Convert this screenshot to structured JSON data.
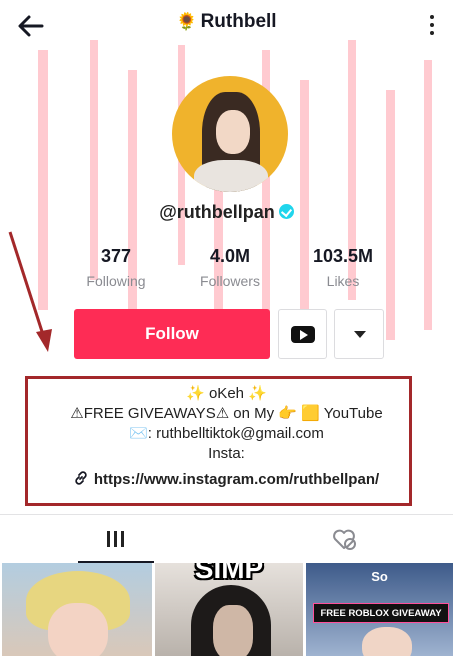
{
  "header": {
    "title": "Ruthbell",
    "title_emoji": "🌻"
  },
  "profile": {
    "handle": "@ruthbellpan",
    "stats": [
      {
        "value": "377",
        "label": "Following"
      },
      {
        "value": "4.0M",
        "label": "Followers"
      },
      {
        "value": "103.5M",
        "label": "Likes"
      }
    ],
    "follow_label": "Follow"
  },
  "bio": {
    "line1": "✨ oKeh ✨",
    "line2": "⚠FREE GIVEAWAYS⚠ on My 👉 🟨 YouTube",
    "line3": "✉️: ruthbelltiktok@gmail.com",
    "line4": "Insta:",
    "link": "https://www.instagram.com/ruthbellpan/"
  },
  "videos": [
    {
      "overlay": ""
    },
    {
      "overlay": "SIMP"
    },
    {
      "overlay": "So",
      "banner": "FREE ROBLOX GIVEAWAY"
    }
  ],
  "colors": {
    "follow": "#fe2c55",
    "annotation": "#a3282a",
    "verified": "#20d5ec"
  }
}
